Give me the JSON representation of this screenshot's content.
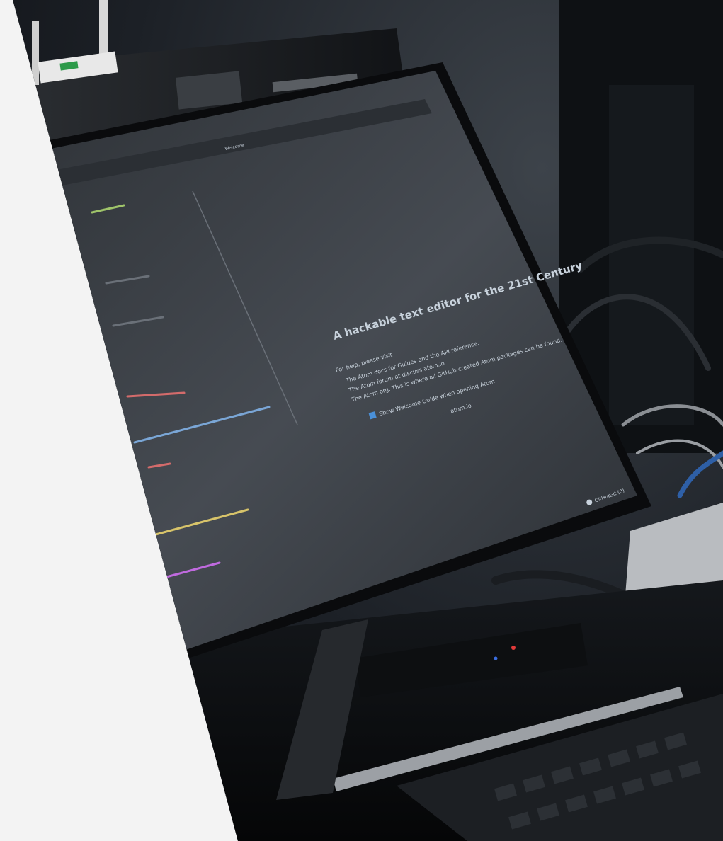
{
  "screen": {
    "tab_label": "Welcome",
    "headline": "A hackable text editor for the 21st Century",
    "help_intro": "For help, please visit",
    "bullets": [
      "The Atom docs for Guides and the API reference.",
      "The Atom forum at discuss.atom.io",
      "The Atom org. This is where all GitHub-created Atom packages can be found."
    ],
    "checkbox_label": "Show Welcome Guide when opening Atom",
    "footer_link": "atom.io",
    "status_github": "GitHub",
    "status_git": "Git (0)"
  },
  "colors": {
    "background": "#f3f3f3",
    "screen": "#3a3f46",
    "accent_blue": "#4a90d9"
  }
}
